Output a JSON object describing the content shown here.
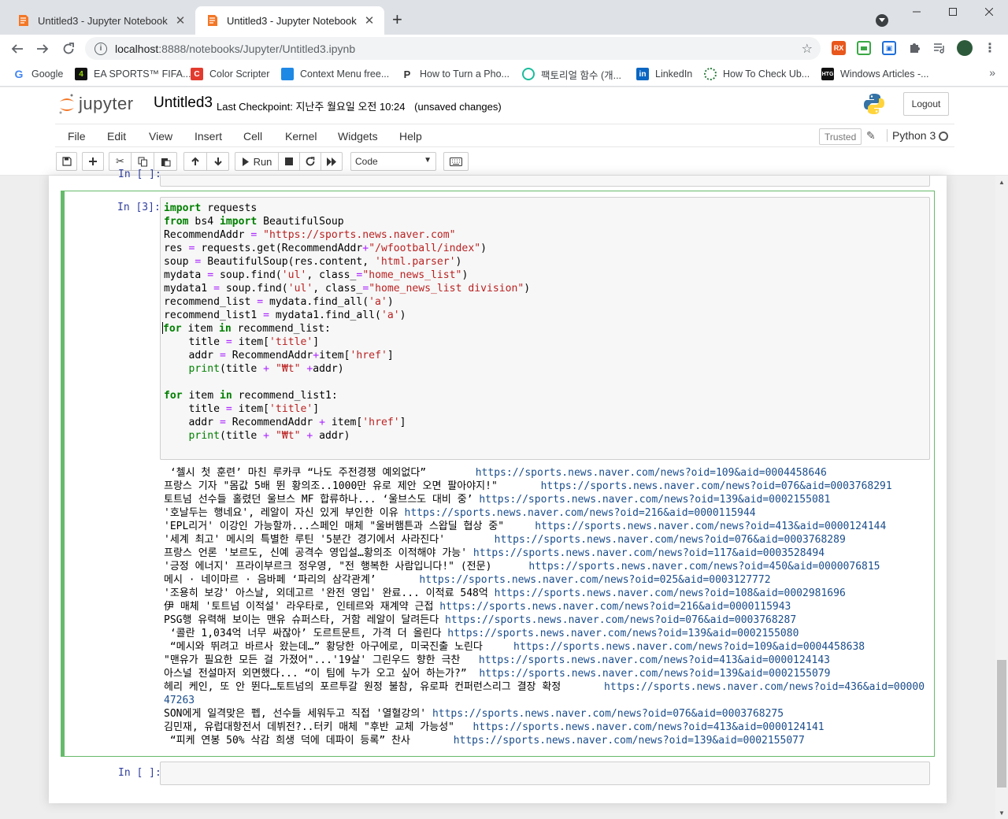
{
  "browser": {
    "tabs": [
      {
        "title": "Untitled3 - Jupyter Notebook",
        "active": false
      },
      {
        "title": "Untitled3 - Jupyter Notebook",
        "active": true
      }
    ],
    "url_host": "localhost",
    "url_path": ":8888/notebooks/Jupyter/Untitled3.ipynb",
    "bookmarks": [
      {
        "label": "Google",
        "icon": "google-icon"
      },
      {
        "label": "EA SPORTS™ FIFA...",
        "icon": "ea-sports-icon"
      },
      {
        "label": "Color Scripter",
        "icon": "color-scripter-icon"
      },
      {
        "label": "Context Menu free...",
        "icon": "context-menu-icon"
      },
      {
        "label": "How to Turn a Pho...",
        "icon": "photo-icon"
      },
      {
        "label": "팩토리얼 함수 (개...",
        "icon": "factorial-icon"
      },
      {
        "label": "LinkedIn",
        "icon": "linkedin-icon"
      },
      {
        "label": "How To Check Ub...",
        "icon": "ubuntu-icon"
      },
      {
        "label": "Windows Articles -...",
        "icon": "htg-icon"
      }
    ]
  },
  "jupyter": {
    "logo_text": "jupyter",
    "notebook_name": "Untitled3",
    "checkpoint_label": "Last Checkpoint:",
    "checkpoint_time": "지난주 월요일 오전 10:24",
    "unsaved": "(unsaved changes)",
    "logout": "Logout",
    "menu": [
      "File",
      "Edit",
      "View",
      "Insert",
      "Cell",
      "Kernel",
      "Widgets",
      "Help"
    ],
    "trusted": "Trusted",
    "kernel": "Python 3",
    "run_label": "Run",
    "cell_type": "Code"
  },
  "cells": {
    "prev_prompt": "In [ ]:",
    "current_prompt": "In [3]:",
    "empty_prompt": "In [ ]:"
  },
  "output_lines": [
    {
      "text": " ‘첼시 첫 훈련’ 마친 루카쿠 “나도 주전경쟁 예외없다”        ",
      "url": "https://sports.news.naver.com/news?oid=109&aid=0004458646"
    },
    {
      "text": "프랑스 기자 \"몸값 5배 뛴 황의조..1000만 유로 제안 오면 팔아야지!\"       ",
      "url": "https://sports.news.naver.com/news?oid=076&aid=0003768291"
    },
    {
      "text": "토트넘 선수들 홀렸던 울브스 MF 합류하나... ‘울브스도 대비 중’ ",
      "url": "https://sports.news.naver.com/news?oid=139&aid=0002155081"
    },
    {
      "text": "'호날두는 행네요', 레알이 자신 있게 부인한 이유 ",
      "url": "https://sports.news.naver.com/news?oid=216&aid=0000115944"
    },
    {
      "text": "'EPL리거' 이강인 가능할까...스페인 매체 \"울버햄튼과 스왑딜 협상 중\"     ",
      "url": "https://sports.news.naver.com/news?oid=413&aid=0000124144"
    },
    {
      "text": "'세계 최고' 메시의 특별한 루틴 '5분간 경기에서 사라진다'        ",
      "url": "https://sports.news.naver.com/news?oid=076&aid=0003768289"
    },
    {
      "text": "프랑스 언론 '보르도, 신예 공격수 영입설…황의조 이적해야 가능' ",
      "url": "https://sports.news.naver.com/news?oid=117&aid=0003528494"
    },
    {
      "text": "'긍정 에너지' 프라이부르크 정우영, \"전 행복한 사람입니다!\" (전문)      ",
      "url": "https://sports.news.naver.com/news?oid=450&aid=0000076815"
    },
    {
      "text": "메시 · 네이마르 · 음바페 ‘파리의 삼각관계’       ",
      "url": "https://sports.news.naver.com/news?oid=025&aid=0003127772"
    },
    {
      "text": "'조용히 보강' 아스날, 외데고르 '완전 영입' 완료... 이적료 548억 ",
      "url": "https://sports.news.naver.com/news?oid=108&aid=0002981696"
    },
    {
      "text": "伊 매체 '토트넘 이적설' 라우타로, 인테르와 재계약 근접 ",
      "url": "https://sports.news.naver.com/news?oid=216&aid=0000115943"
    },
    {
      "text": "PSG행 유력해 보이는 맨유 슈퍼스타, 거함 레알이 달려든다 ",
      "url": "https://sports.news.naver.com/news?oid=076&aid=0003768287"
    },
    {
      "text": " ‘콜란 1,034억 너무 싸잖아’ 도르트문트, 가격 더 올린다 ",
      "url": "https://sports.news.naver.com/news?oid=139&aid=0002155080"
    },
    {
      "text": " “메시와 뛰려고 바르사 왔는데…” 황당한 아구에로, 미국진출 노린다     ",
      "url": "https://sports.news.naver.com/news?oid=109&aid=0004458638"
    },
    {
      "text": "\"맨유가 필요한 모든 걸 가졌어\"...'19살' 그린우드 향한 극찬   ",
      "url": "https://sports.news.naver.com/news?oid=413&aid=0000124143"
    },
    {
      "text": "아스널 전설마저 외면했다... “이 팀에 누가 오고 싶어 하는가?”  ",
      "url": "https://sports.news.naver.com/news?oid=139&aid=0002155079"
    },
    {
      "text": "헤리 케인, 또 안 뛴다…토트넘의 포르투갈 원정 불참, 유로파 컨퍼런스리그 결장 확정       ",
      "url": "https://sports.news.naver.com/news?oid=436&aid=0000047263",
      "wrap": true
    },
    {
      "text": "SON에게 일격맞은 펩, 선수들 세워두고 직접 '열혈강의' ",
      "url": "https://sports.news.naver.com/news?oid=076&aid=0003768275"
    },
    {
      "text": "김민재, 유럽대항전서 데뷔전?..터키 매체 \"후반 교체 가능성\"   ",
      "url": "https://sports.news.naver.com/news?oid=413&aid=0000124141"
    },
    {
      "text": " “피케 연봉 50% 삭감 희생 덕에 데파이 등록” 찬사       ",
      "url": "https://sports.news.naver.com/news?oid=139&aid=0002155077"
    }
  ]
}
